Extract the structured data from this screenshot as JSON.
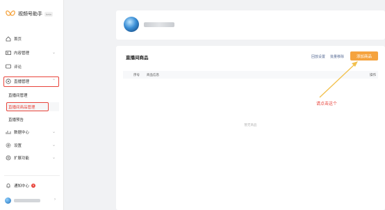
{
  "app": {
    "name": "视频号助手",
    "beta_tag": "beta"
  },
  "sidebar": {
    "items": [
      {
        "label": "首页",
        "icon": "home-icon"
      },
      {
        "label": "内容管理",
        "icon": "image-icon"
      },
      {
        "label": "评论",
        "icon": "comment-icon"
      },
      {
        "label": "直播管理",
        "icon": "live-icon"
      },
      {
        "label": "数据中心",
        "icon": "chart-icon"
      },
      {
        "label": "设置",
        "icon": "gear-icon"
      },
      {
        "label": "扩展功能",
        "icon": "extension-icon"
      }
    ],
    "live_sub_items": [
      {
        "label": "直播间管理"
      },
      {
        "label": "直播间商品管理"
      },
      {
        "label": "直播预告"
      }
    ],
    "notifications": {
      "label": "通知中心",
      "count": "9"
    }
  },
  "main": {
    "card_title": "直播间商品",
    "actions": {
      "reply_settings": "回放设置",
      "batch_remove": "批量移除",
      "add_product": "添加商品"
    },
    "table": {
      "columns": [
        "序号",
        "商品信息",
        "操作"
      ],
      "empty_text": "暂无商品"
    }
  },
  "annotation": {
    "text": "请点击这个"
  },
  "colors": {
    "accent": "#f5a33e",
    "highlight": "#e8433a",
    "link": "#576b95"
  }
}
